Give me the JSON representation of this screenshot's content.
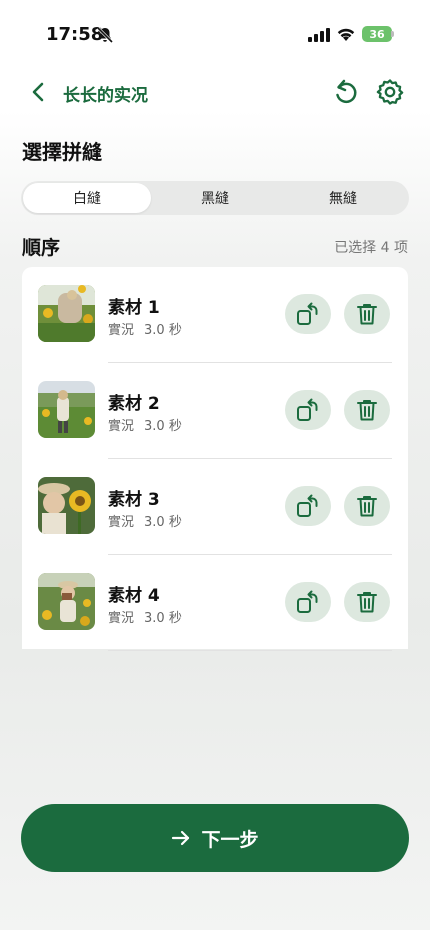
{
  "status_bar": {
    "time": "17:58",
    "battery": "36"
  },
  "header": {
    "title": "长长的实况"
  },
  "stitch": {
    "title": "選擇拼縫",
    "options": [
      "白縫",
      "黑縫",
      "無縫"
    ],
    "selected": "白縫"
  },
  "order": {
    "title": "順序",
    "count_label": "已选择 4 项",
    "items": [
      {
        "name": "素材 1",
        "type": "實況",
        "duration": "3.0 秒"
      },
      {
        "name": "素材 2",
        "type": "實況",
        "duration": "3.0 秒"
      },
      {
        "name": "素材 3",
        "type": "實況",
        "duration": "3.0 秒"
      },
      {
        "name": "素材 4",
        "type": "實況",
        "duration": "3.0 秒"
      }
    ]
  },
  "footer": {
    "next_label": "下一步"
  },
  "colors": {
    "accent": "#1b6b3e",
    "button_tint": "#dde8df"
  },
  "icons": [
    "bell-slash-icon",
    "signal-icon",
    "wifi-icon",
    "battery-icon",
    "chevron-left-icon",
    "rotate-ccw-icon",
    "gear-icon",
    "rotate-icon",
    "trash-icon",
    "arrow-right-icon"
  ]
}
